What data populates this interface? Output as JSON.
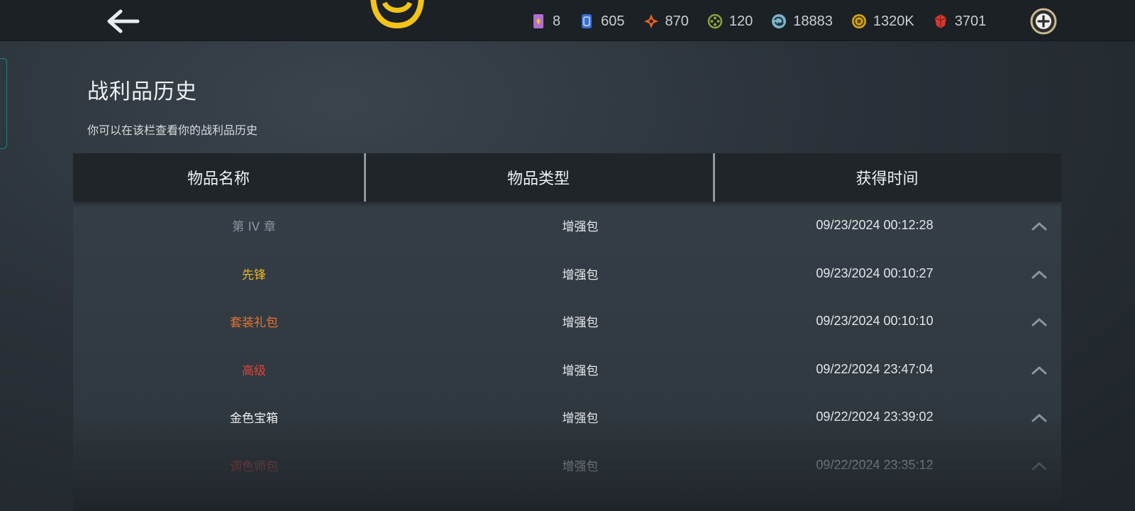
{
  "header": {
    "currencies": [
      {
        "icon": "ticket-icon",
        "value": "8",
        "color": "#b06fd0"
      },
      {
        "icon": "card-icon",
        "value": "605",
        "color": "#3b6fd8"
      },
      {
        "icon": "diamond-star-icon",
        "value": "870",
        "color": "#e0612b"
      },
      {
        "icon": "token-icon",
        "value": "120",
        "color": "#8aa33a"
      },
      {
        "icon": "swirl-orb-icon",
        "value": "18883",
        "color": "#7fb3c9"
      },
      {
        "icon": "gold-coin-icon",
        "value": "1320K",
        "color": "#d4a820"
      },
      {
        "icon": "red-gem-icon",
        "value": "3701",
        "color": "#d63a2e"
      }
    ]
  },
  "page": {
    "title": "战利品历史",
    "subtitle": "你可以在该栏查看你的战利品历史"
  },
  "table": {
    "columns": [
      "物品名称",
      "物品类型",
      "获得时间"
    ],
    "rows": [
      {
        "name": "第 IV 章",
        "name_color": "#8b97a3",
        "type": "增强包",
        "time": "09/23/2024 00:12:28"
      },
      {
        "name": "先锋",
        "name_color": "#e8b52a",
        "type": "增强包",
        "time": "09/23/2024 00:10:27"
      },
      {
        "name": "套装礼包",
        "name_color": "#e8742e",
        "type": "增强包",
        "time": "09/23/2024 00:10:10"
      },
      {
        "name": "高级",
        "name_color": "#d9443a",
        "type": "增强包",
        "time": "09/22/2024 23:47:04"
      },
      {
        "name": "金色宝箱",
        "name_color": "#f0f2f4",
        "type": "增强包",
        "time": "09/22/2024 23:39:02"
      },
      {
        "name": "调色师包",
        "name_color": "#c94d48",
        "type": "增强包",
        "time": "09/22/2024 23:35:12"
      }
    ]
  },
  "colors": {
    "logo": "#f2c318",
    "accent_teal": "#1f7f86"
  }
}
